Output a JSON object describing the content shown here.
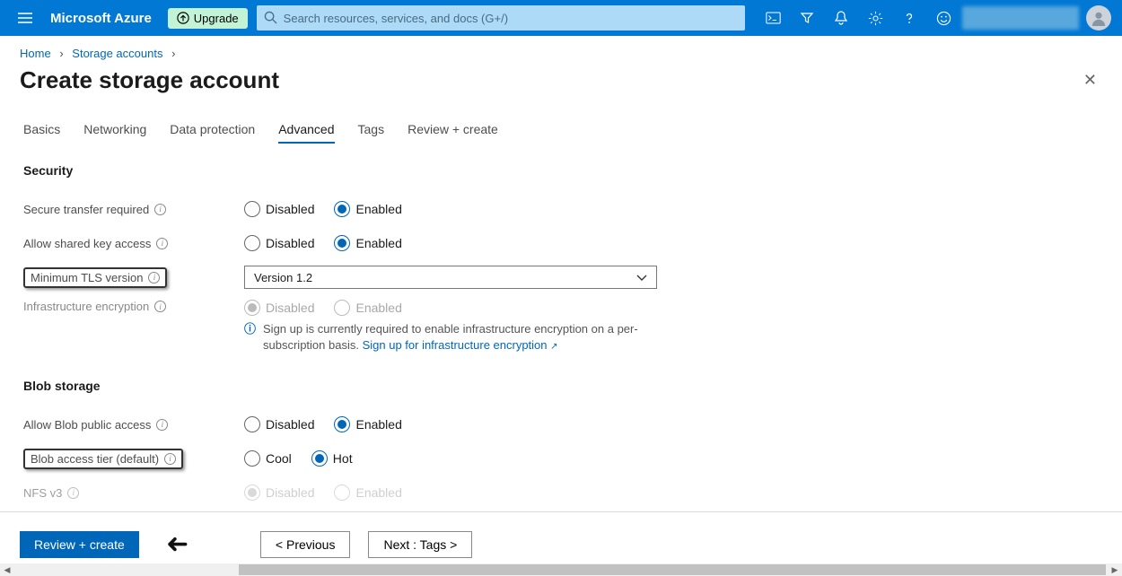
{
  "header": {
    "brand": "Microsoft Azure",
    "upgrade_label": "Upgrade",
    "search_placeholder": "Search resources, services, and docs (G+/)"
  },
  "breadcrumbs": {
    "home": "Home",
    "storage_accounts": "Storage accounts"
  },
  "page_title": "Create storage account",
  "tabs": {
    "basics": "Basics",
    "networking": "Networking",
    "data_protection": "Data protection",
    "advanced": "Advanced",
    "tags": "Tags",
    "review": "Review + create"
  },
  "sections": {
    "security": "Security",
    "blob_storage": "Blob storage"
  },
  "labels": {
    "secure_transfer": "Secure transfer required",
    "shared_key": "Allow shared key access",
    "min_tls": "Minimum TLS version",
    "infra_enc": "Infrastructure encryption",
    "blob_public": "Allow Blob public access",
    "blob_tier": "Blob access tier (default)",
    "nfs": "NFS v3"
  },
  "options": {
    "disabled": "Disabled",
    "enabled": "Enabled",
    "cool": "Cool",
    "hot": "Hot"
  },
  "values": {
    "tls_version": "Version 1.2"
  },
  "hint": {
    "text_a": "Sign up is currently required to enable infrastructure encryption on a per-subscription basis. ",
    "link": "Sign up for infrastructure encryption"
  },
  "footer": {
    "review": "Review + create",
    "previous": "<  Previous",
    "next": "Next : Tags  >"
  }
}
